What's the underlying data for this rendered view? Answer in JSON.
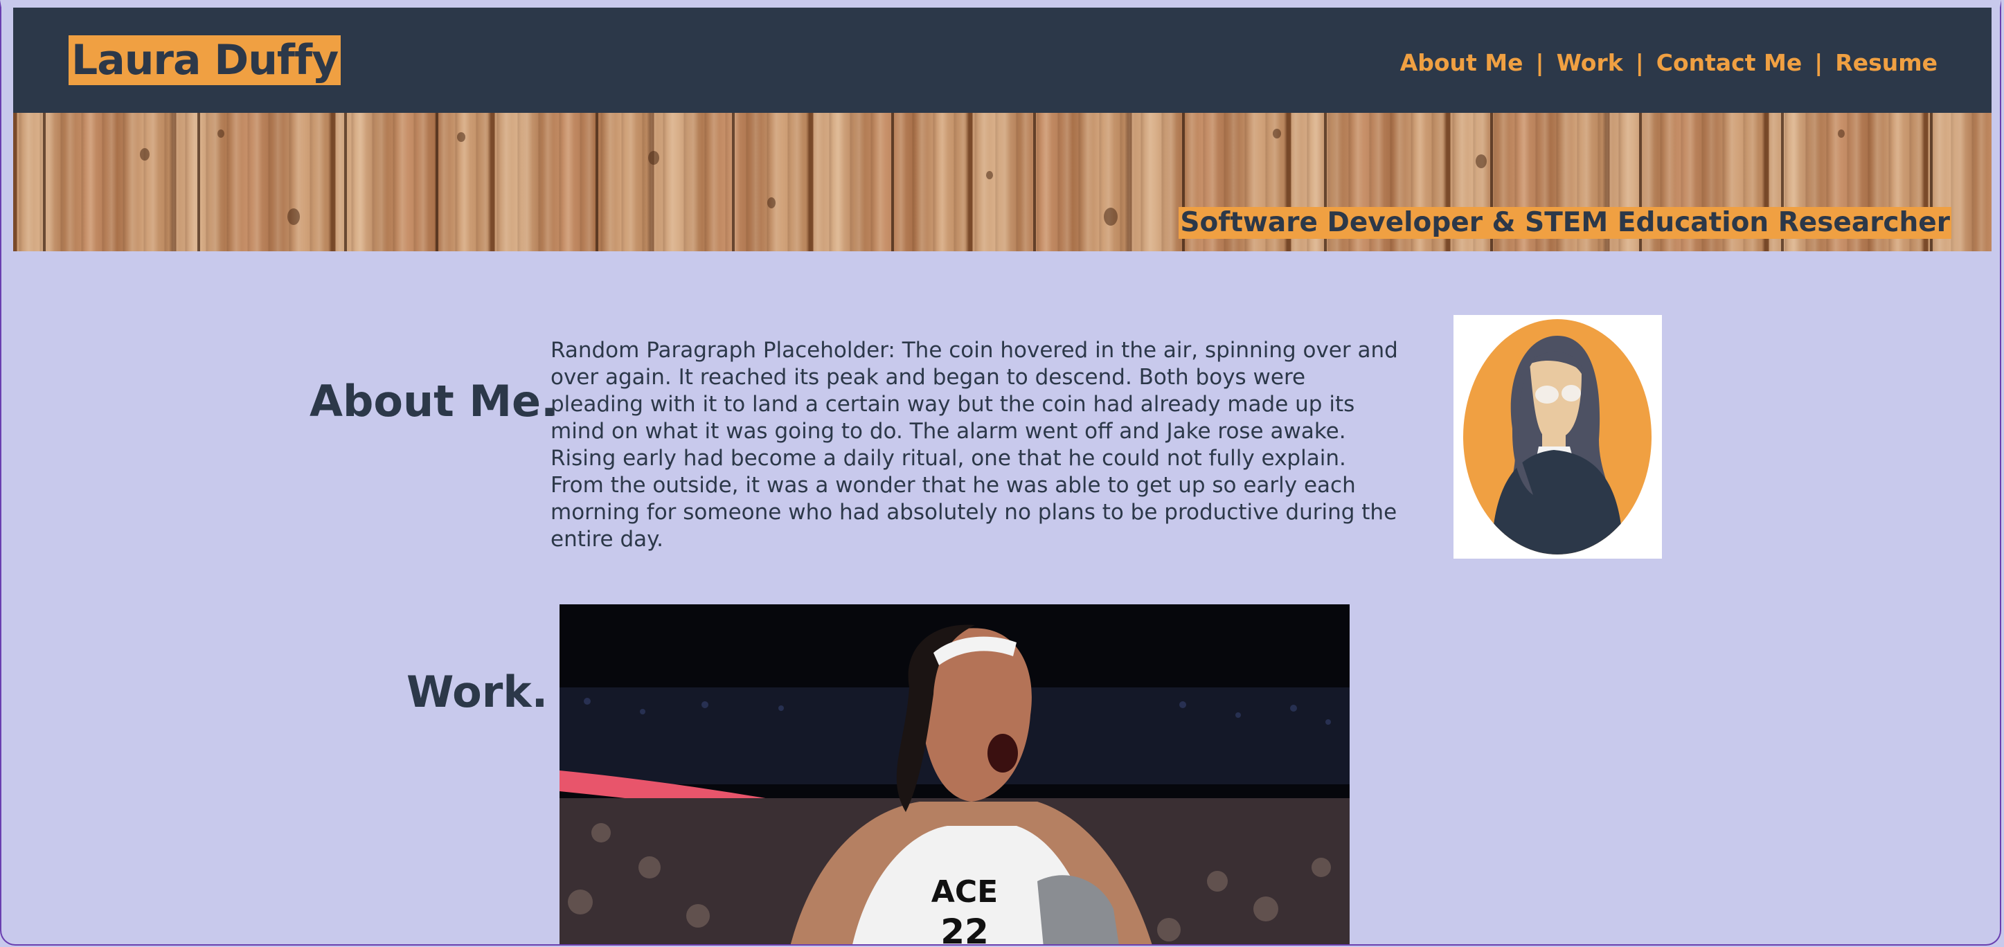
{
  "header": {
    "name": "Laura Duffy",
    "nav": [
      {
        "label": "About Me"
      },
      {
        "label": "Work"
      },
      {
        "label": "Contact Me"
      },
      {
        "label": "Resume"
      }
    ],
    "separator": "|"
  },
  "banner": {
    "tagline": "Software Developer & STEM Education Researcher"
  },
  "about": {
    "title": "About Me.",
    "text": "Random Paragraph Placeholder: The coin hovered in the air, spinning over and over again. It reached its peak and began to descend. Both boys were pleading with it to land a certain way but the coin had already made up its mind on what it was going to do. The alarm went off and Jake rose awake. Rising early had become a daily ritual, one that he could not fully explain. From the outside, it was a wonder that he was able to get up so early each morning for someone who had absolutely no plans to be productive during the entire day."
  },
  "work": {
    "title": "Work.",
    "image_icon": "basketball-player-photo"
  },
  "colors": {
    "navy": "#2c3849",
    "accent": "#f0a042",
    "background": "#c8c9ec",
    "border": "#6a3fb0"
  }
}
